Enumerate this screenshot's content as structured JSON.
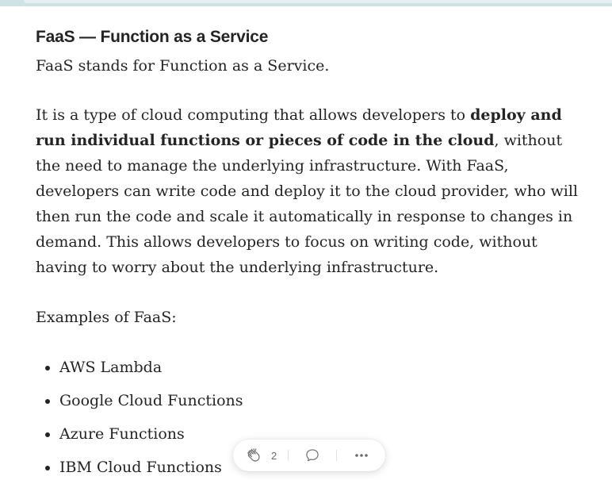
{
  "article": {
    "heading": "FaaS — Function as a Service",
    "intro": "FaaS stands for Function as a Service.",
    "para2_before": "It is a type of cloud computing that allows developers to ",
    "para2_bold": "deploy and run individual functions or pieces of code in the cloud",
    "para2_after": ", without the need to manage the underlying infrastructure. With FaaS, developers can write code and deploy it to the cloud provider, who will then run the code and scale it automatically in response to changes in demand. This allows developers to focus on writing code, without having to worry about the underlying infrastructure.",
    "examples_label": "Examples of FaaS:",
    "examples": [
      "AWS Lambda",
      "Google Cloud Functions",
      "Azure Functions",
      "IBM Cloud Functions"
    ]
  },
  "action_bar": {
    "clap_count": "2",
    "clap_icon": "clap-icon",
    "comment_icon": "comment-icon",
    "more_icon": "more-icon"
  },
  "colors": {
    "text": "#242424",
    "muted": "#6b6b6b",
    "top_strip": "#cfe3e6"
  }
}
